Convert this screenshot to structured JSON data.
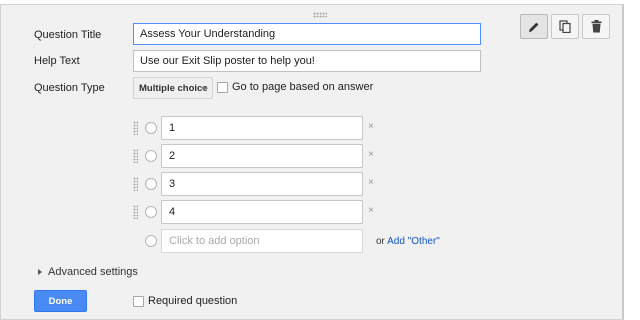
{
  "toolbar": {
    "edit_icon": "pencil-icon",
    "duplicate_icon": "duplicate-icon",
    "delete_icon": "trash-icon"
  },
  "question": {
    "title_label": "Question Title",
    "title_value": "Assess Your Understanding",
    "help_label": "Help Text",
    "help_value": "Use our Exit Slip poster to help you!",
    "type_label": "Question Type",
    "type_value": "Multiple choice",
    "go_to_page_label": "Go to page based on answer"
  },
  "options": [
    {
      "value": "1",
      "remove": "×"
    },
    {
      "value": "2",
      "remove": "×"
    },
    {
      "value": "3",
      "remove": "×"
    },
    {
      "value": "4",
      "remove": "×"
    }
  ],
  "add_option": {
    "placeholder": "Click to add option",
    "or_text": "or",
    "add_other_link": "Add \"Other\""
  },
  "footer": {
    "advanced_settings": "Advanced settings",
    "done_button": "Done",
    "required_label": "Required question"
  },
  "colors": {
    "accent": "#4a8af4",
    "link": "#1155cc",
    "focus": "#4d90fe"
  }
}
